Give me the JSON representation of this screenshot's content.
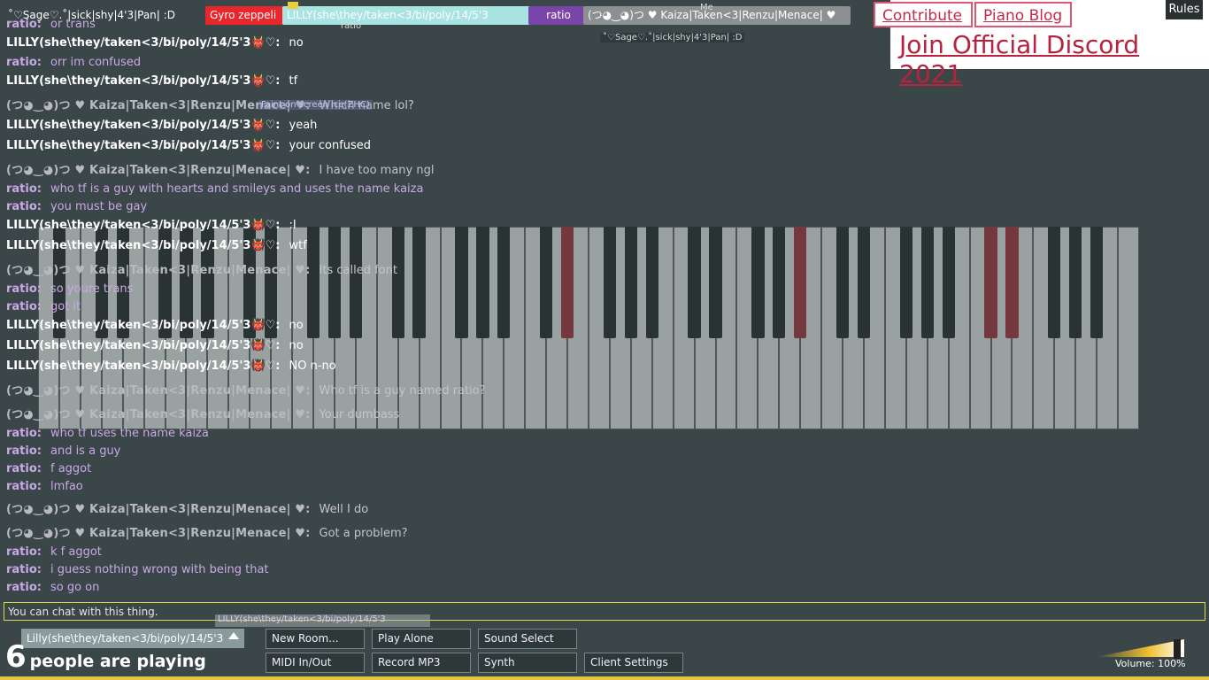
{
  "participants": [
    {
      "label": "˚♡Sage♡.˚|sick|shy|4'3|Pan| :D",
      "color": "#3b4648"
    },
    {
      "label": "Gyro zeppeli",
      "color": "#e8262b"
    },
    {
      "label": "LILLY(she\\they/taken<3/bi/poly/14/5'3",
      "color": "#a9e3e2"
    },
    {
      "label": "ratio",
      "color": "#7a45a8"
    },
    {
      "label": "(つ◕‿◕)つ ♥ Kaiza|Taken<3|Renzu|Menace| ♥",
      "color": "#8a9190"
    }
  ],
  "participant_subs": {
    "ratio_sub": "ratio",
    "me_tag": "Me",
    "sage_float": "˚♡Sage♡.˚|sick|shy|4'3|Pan| :D",
    "floating_hint": "Faint on screen ice(ZHC)"
  },
  "links": {
    "contribute": "Contribute",
    "piano_blog": "Piano Blog",
    "discord": "Join Official Discord 2021",
    "rules": "Rules"
  },
  "chat": [
    {
      "who": "ratio:",
      "text": "or trans",
      "kind": "ratio"
    },
    {
      "who": "LILLY(she\\they/taken<3/bi/poly/14/5'3👹♡:",
      "text": "no",
      "kind": "lilly"
    },
    {
      "who": "ratio:",
      "text": "orr im confused",
      "kind": "ratio"
    },
    {
      "who": "LILLY(she\\they/taken<3/bi/poly/14/5'3👹♡:",
      "text": "tf",
      "kind": "lilly"
    },
    {
      "who": "(つ◕‿◕)つ ♥ Kaiza|Taken<3|Renzu|Menace| ♥:",
      "text": "Which name lol?",
      "kind": "kaiza"
    },
    {
      "who": "LILLY(she\\they/taken<3/bi/poly/14/5'3👹♡:",
      "text": "yeah",
      "kind": "lilly"
    },
    {
      "who": "LILLY(she\\they/taken<3/bi/poly/14/5'3👹♡:",
      "text": "your confused",
      "kind": "lilly"
    },
    {
      "who": "(つ◕‿◕)つ ♥ Kaiza|Taken<3|Renzu|Menace| ♥:",
      "text": "I have too many ngl",
      "kind": "kaiza"
    },
    {
      "who": "ratio:",
      "text": "who tf is a guy with hearts and smileys and uses the name kaiza",
      "kind": "ratio"
    },
    {
      "who": "ratio:",
      "text": "you must be gay",
      "kind": "ratio"
    },
    {
      "who": "LILLY(she\\they/taken<3/bi/poly/14/5'3👹♡:",
      "text": ":I",
      "kind": "lilly"
    },
    {
      "who": "LILLY(she\\they/taken<3/bi/poly/14/5'3👹♡:",
      "text": "wtf",
      "kind": "lilly"
    },
    {
      "who": "(つ◕‿◕)つ ♥ Kaiza|Taken<3|Renzu|Menace| ♥:",
      "text": "Its called font",
      "kind": "kaiza"
    },
    {
      "who": "ratio:",
      "text": "so youre trans",
      "kind": "ratio"
    },
    {
      "who": "ratio:",
      "text": "got it",
      "kind": "ratio"
    },
    {
      "who": "LILLY(she\\they/taken<3/bi/poly/14/5'3👹♡:",
      "text": "no",
      "kind": "lilly"
    },
    {
      "who": "LILLY(she\\they/taken<3/bi/poly/14/5'3👹♡:",
      "text": "no",
      "kind": "lilly"
    },
    {
      "who": "LILLY(she\\they/taken<3/bi/poly/14/5'3👹♡:",
      "text": "NO n-no",
      "kind": "lilly"
    },
    {
      "who": "(つ◕‿◕)つ ♥ Kaiza|Taken<3|Renzu|Menace| ♥:",
      "text": "Who tf is a guy named ratio?",
      "kind": "kaiza"
    },
    {
      "who": "(つ◕‿◕)つ ♥ Kaiza|Taken<3|Renzu|Menace| ♥:",
      "text": "Your dumbass",
      "kind": "kaiza"
    },
    {
      "who": "ratio:",
      "text": "who tf uses the name kaiza",
      "kind": "ratio"
    },
    {
      "who": "ratio:",
      "text": "and is a guy",
      "kind": "ratio"
    },
    {
      "who": "ratio:",
      "text": "f aggot",
      "kind": "ratio"
    },
    {
      "who": "ratio:",
      "text": "lmfao",
      "kind": "ratio"
    },
    {
      "who": "(つ◕‿◕)つ ♥ Kaiza|Taken<3|Renzu|Menace| ♥:",
      "text": "Well I do",
      "kind": "kaiza"
    },
    {
      "who": "(つ◕‿◕)つ ♥ Kaiza|Taken<3|Renzu|Menace| ♥:",
      "text": "Got a problem?",
      "kind": "kaiza"
    },
    {
      "who": "ratio:",
      "text": "k f aggot",
      "kind": "ratio"
    },
    {
      "who": "ratio:",
      "text": "i guess nothing wrong with being that",
      "kind": "ratio"
    },
    {
      "who": "ratio:",
      "text": "so go on",
      "kind": "ratio"
    }
  ],
  "chat_input": {
    "placeholder": "You can chat with this thing.",
    "value": ""
  },
  "bottom": {
    "my_name": "Lilly(she\\they/taken<3/bi/poly/14/5'3",
    "ghost_name": "LILLY(she\\they/taken<3/bi/poly/14/5'3",
    "player_count": "6",
    "player_label": "people are playing",
    "buttons": {
      "new_room": "New Room...",
      "play_alone": "Play Alone",
      "sound_select": "Sound Select",
      "midi": "MIDI In/Out",
      "record": "Record MP3",
      "synth": "Synth",
      "client_settings": "Client Settings"
    },
    "volume_label": "Volume: 100%",
    "volume_level": 1.0
  },
  "colors": {
    "background": "#3b4648",
    "ratio": "#c9a8e6",
    "kaiza": "#b9b9c2",
    "lilly": "#ffffff",
    "accent_link": "#c62a47"
  }
}
